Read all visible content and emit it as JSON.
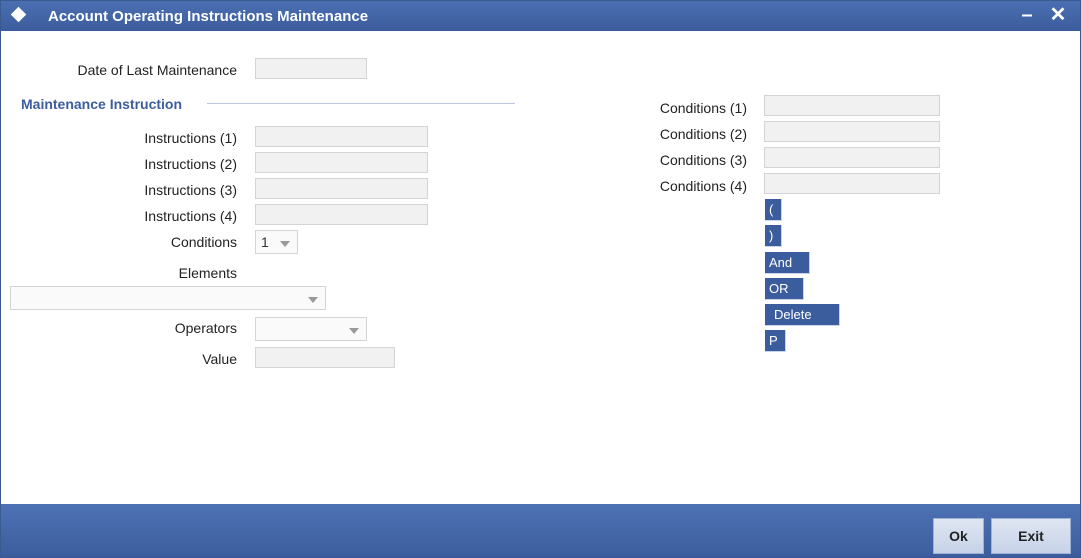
{
  "window": {
    "title": "Account Operating Instructions Maintenance",
    "minimize_glyph": "–",
    "close_glyph": "✕"
  },
  "form": {
    "date_label": "Date of Last Maintenance",
    "date_value": "",
    "section_title": "Maintenance Instruction",
    "instructions": [
      "Instructions (1)",
      "Instructions (2)",
      "Instructions (3)",
      "Instructions (4)"
    ],
    "conditions_label": "Conditions",
    "conditions_selected": "1",
    "elements_label": "Elements",
    "elements_selected": "",
    "operators_label": "Operators",
    "operators_selected": "",
    "value_label": "Value",
    "value_value": ""
  },
  "conditions_panel": {
    "labels": [
      "Conditions (1)",
      "Conditions (2)",
      "Conditions (3)",
      "Conditions (4)"
    ]
  },
  "operator_buttons": [
    "(",
    ")",
    "And",
    "OR",
    "Delete",
    "P"
  ],
  "footer": {
    "ok_label": "Ok",
    "exit_label": "Exit"
  },
  "colors": {
    "titlebar": "#3c5d9d",
    "section_title": "#3c5d9d",
    "field_bg": "#f1f1f1"
  }
}
